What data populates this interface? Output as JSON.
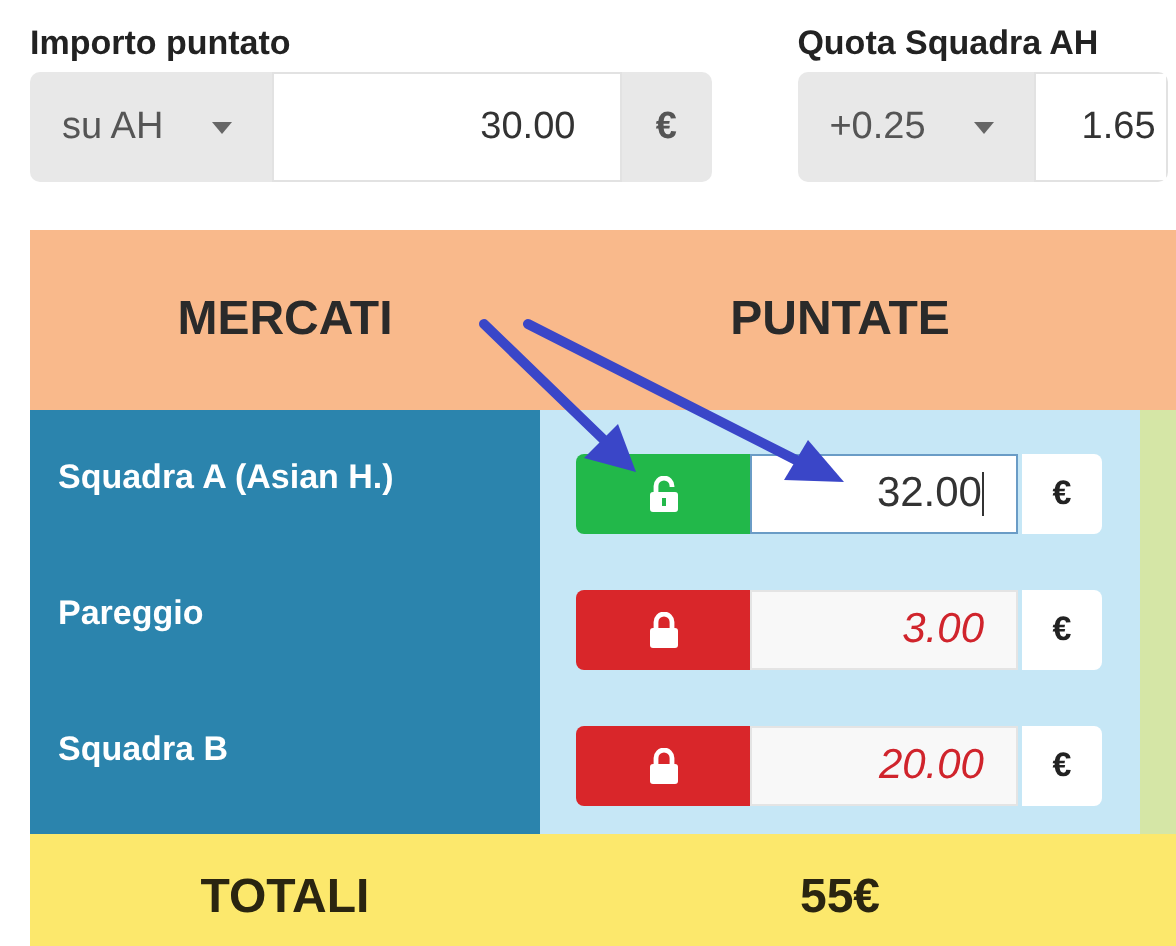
{
  "fields": [
    {
      "label": "Importo puntato",
      "select": "su AH",
      "value": "30.00",
      "unit": "€"
    },
    {
      "label": "Quota Squadra AH",
      "select": "+0.25",
      "value": "1.65"
    }
  ],
  "table": {
    "columns": [
      "MERCATI",
      "PUNTATE"
    ],
    "rows": [
      {
        "market": "Squadra A (Asian H.)",
        "locked": false,
        "focused": true,
        "value": "32.00",
        "unit": "€"
      },
      {
        "market": "Pareggio",
        "locked": true,
        "focused": false,
        "value": "3.00",
        "unit": "€"
      },
      {
        "market": "Squadra B",
        "locked": true,
        "focused": false,
        "value": "20.00",
        "unit": "€"
      }
    ],
    "totals": {
      "label": "TOTALI",
      "value": "55€"
    }
  }
}
